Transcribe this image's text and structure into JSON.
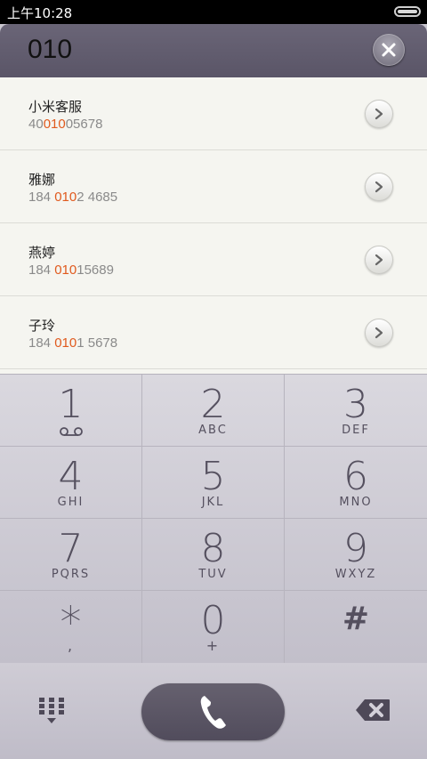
{
  "status_bar": {
    "time": "上午10:28"
  },
  "search": {
    "query": "010"
  },
  "results": [
    {
      "name": "小米客服",
      "phone_pre": "40",
      "phone_match": "010",
      "phone_post": "05678"
    },
    {
      "name": "雅娜",
      "phone_pre": "184 ",
      "phone_match": "010",
      "phone_post": "2 4685"
    },
    {
      "name": "燕婷",
      "phone_pre": "184 ",
      "phone_match": "010",
      "phone_post": "15689"
    },
    {
      "name": "子玲",
      "phone_pre": "184 ",
      "phone_match": "010",
      "phone_post": "1 5678"
    }
  ],
  "keypad": {
    "keys": [
      {
        "digit": "1",
        "letters": "voicemail-icon"
      },
      {
        "digit": "2",
        "letters": "ABC"
      },
      {
        "digit": "3",
        "letters": "DEF"
      },
      {
        "digit": "4",
        "letters": "GHI"
      },
      {
        "digit": "5",
        "letters": "JKL"
      },
      {
        "digit": "6",
        "letters": "MNO"
      },
      {
        "digit": "7",
        "letters": "PQRS"
      },
      {
        "digit": "8",
        "letters": "TUV"
      },
      {
        "digit": "9",
        "letters": "WXYZ"
      },
      {
        "digit": "*",
        "letters": ","
      },
      {
        "digit": "0",
        "letters": "+"
      },
      {
        "digit": "#",
        "letters": ""
      }
    ]
  },
  "colors": {
    "match_highlight": "#e05a1e",
    "header_bg": "#5f5a6c",
    "call_button": "#5a5565"
  },
  "icons": {
    "clear": "close-icon",
    "row_action": "chevron-right-icon",
    "dialpad": "dialpad-icon",
    "call": "phone-icon",
    "delete": "backspace-icon"
  }
}
